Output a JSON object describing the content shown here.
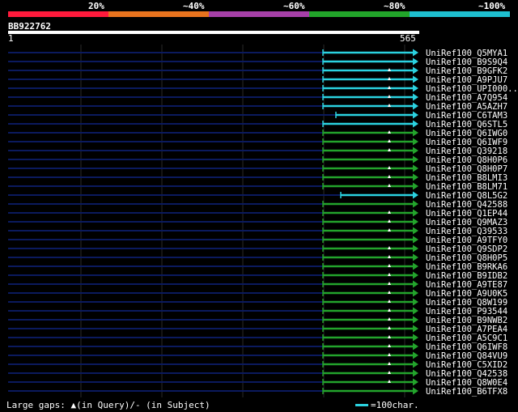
{
  "identity_legend": [
    {
      "label": "20%",
      "color": "#ff1a3c"
    },
    {
      "label": "~40%",
      "color": "#e8731e"
    },
    {
      "label": "~60%",
      "color": "#a640a8"
    },
    {
      "label": "~80%",
      "color": "#22a52a"
    },
    {
      "label": "~100%",
      "color": "#1ec0d0"
    }
  ],
  "query": {
    "name": "BB922762",
    "start": "1",
    "end": "565"
  },
  "colors": {
    "cyan": "#2bd2e0",
    "green": "#23a42c",
    "navy": "#0b1a5e",
    "grid": "#2a2a2a"
  },
  "hits": [
    {
      "label": "UniRef100_Q5MYA1",
      "color": "cyan",
      "start": 399,
      "gap": false
    },
    {
      "label": "UniRef100_B9S9Q4",
      "color": "cyan",
      "start": 399,
      "gap": false
    },
    {
      "label": "UniRef100_B9GFK2",
      "color": "cyan",
      "start": 399,
      "gap": true
    },
    {
      "label": "UniRef100_A9PJU7",
      "color": "cyan",
      "start": 399,
      "gap": true
    },
    {
      "label": "UniRef100_UPI000..",
      "color": "cyan",
      "start": 399,
      "gap": true
    },
    {
      "label": "UniRef100_A7Q954",
      "color": "cyan",
      "start": 399,
      "gap": true
    },
    {
      "label": "UniRef100_A5AZH7",
      "color": "cyan",
      "start": 399,
      "gap": true
    },
    {
      "label": "UniRef100_C6TAM3",
      "color": "cyan",
      "start": 415,
      "gap": false
    },
    {
      "label": "UniRef100_Q6STL5",
      "color": "cyan",
      "start": 399,
      "gap": false
    },
    {
      "label": "UniRef100_Q6IWG0",
      "color": "green",
      "start": 399,
      "gap": true
    },
    {
      "label": "UniRef100_Q6IWF9",
      "color": "green",
      "start": 399,
      "gap": true
    },
    {
      "label": "UniRef100_Q39218",
      "color": "green",
      "start": 399,
      "gap": true
    },
    {
      "label": "UniRef100_Q8H0P6",
      "color": "green",
      "start": 399,
      "gap": false
    },
    {
      "label": "UniRef100_Q8H0P7",
      "color": "green",
      "start": 399,
      "gap": true
    },
    {
      "label": "UniRef100_B8LMI3",
      "color": "green",
      "start": 399,
      "gap": true
    },
    {
      "label": "UniRef100_B8LM71",
      "color": "green",
      "start": 399,
      "gap": true
    },
    {
      "label": "UniRef100_Q8L5G2",
      "color": "cyan",
      "start": 421,
      "gap": false
    },
    {
      "label": "UniRef100_Q42588",
      "color": "green",
      "start": 399,
      "gap": false
    },
    {
      "label": "UniRef100_Q1EP44",
      "color": "green",
      "start": 399,
      "gap": true
    },
    {
      "label": "UniRef100_Q9MAZ3",
      "color": "green",
      "start": 399,
      "gap": true
    },
    {
      "label": "UniRef100_Q39533",
      "color": "green",
      "start": 399,
      "gap": true
    },
    {
      "label": "UniRef100_A9TFY0",
      "color": "green",
      "start": 399,
      "gap": false
    },
    {
      "label": "UniRef100_Q9SDP2",
      "color": "green",
      "start": 399,
      "gap": true
    },
    {
      "label": "UniRef100_Q8H0P5",
      "color": "green",
      "start": 399,
      "gap": true
    },
    {
      "label": "UniRef100_B9RKA6",
      "color": "green",
      "start": 399,
      "gap": true
    },
    {
      "label": "UniRef100_B9IDB2",
      "color": "green",
      "start": 399,
      "gap": true
    },
    {
      "label": "UniRef100_A9TE87",
      "color": "green",
      "start": 399,
      "gap": true
    },
    {
      "label": "UniRef100_A9U0K5",
      "color": "green",
      "start": 399,
      "gap": true
    },
    {
      "label": "UniRef100_Q8W199",
      "color": "green",
      "start": 399,
      "gap": true
    },
    {
      "label": "UniRef100_P93544",
      "color": "green",
      "start": 399,
      "gap": true
    },
    {
      "label": "UniRef100_B9NWB2",
      "color": "green",
      "start": 399,
      "gap": true
    },
    {
      "label": "UniRef100_A7PEA4",
      "color": "green",
      "start": 399,
      "gap": true
    },
    {
      "label": "UniRef100_A5C9C1",
      "color": "green",
      "start": 399,
      "gap": true
    },
    {
      "label": "UniRef100_Q6IWF8",
      "color": "green",
      "start": 399,
      "gap": true
    },
    {
      "label": "UniRef100_Q84VU9",
      "color": "green",
      "start": 399,
      "gap": true
    },
    {
      "label": "UniRef100_C5XID2",
      "color": "green",
      "start": 399,
      "gap": true
    },
    {
      "label": "UniRef100_Q42538",
      "color": "green",
      "start": 399,
      "gap": true
    },
    {
      "label": "UniRef100_Q8W0E4",
      "color": "green",
      "start": 399,
      "gap": true
    },
    {
      "label": "UniRef100_B6TFX8",
      "color": "green",
      "start": 399,
      "gap": false
    }
  ],
  "footer": {
    "gaps_text": "Large gaps: ▲(in Query)/- (in Subject)",
    "scale_text": "=100char."
  }
}
